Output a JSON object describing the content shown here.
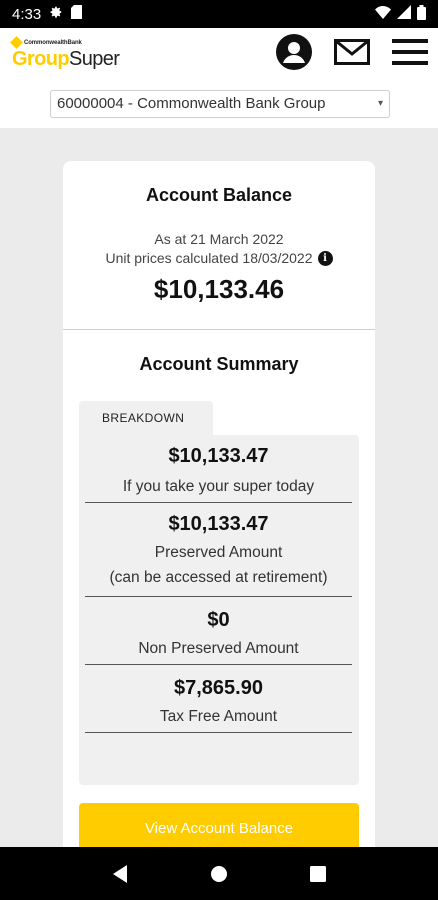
{
  "status_bar": {
    "time": "4:33"
  },
  "header": {
    "brand": {
      "top": "CommonwealthBank",
      "name_a": "Group",
      "name_b": "Super"
    },
    "account_select": {
      "value": "60000004 - Commonwealth Bank Group"
    }
  },
  "account_balance": {
    "title": "Account Balance",
    "as_at": "As at 21 March 2022",
    "unit_prices": "Unit prices calculated 18/03/2022",
    "amount": "$10,133.46"
  },
  "account_summary": {
    "title": "Account Summary",
    "tab": "BREAKDOWN",
    "rows": [
      {
        "amount": "$10,133.47",
        "label": "If you take your super today"
      },
      {
        "amount": "$10,133.47",
        "label": "Preserved Amount",
        "sublabel": "(can be accessed at retirement)"
      },
      {
        "amount": "$0",
        "label": "Non Preserved Amount"
      },
      {
        "amount": "$7,865.90",
        "label": "Tax Free Amount"
      }
    ]
  },
  "view_button": {
    "label": "View Account Balance"
  },
  "colors": {
    "accent": "#ffcc00",
    "background": "#ebebeb",
    "card": "#ffffff",
    "panel": "#f0f0f0"
  },
  "icons": [
    "gear-icon",
    "sim-icon",
    "wifi-icon",
    "signal-icon",
    "battery-icon",
    "profile-icon",
    "mail-icon",
    "menu-icon",
    "back-icon",
    "home-icon",
    "recents-icon",
    "info-icon"
  ]
}
